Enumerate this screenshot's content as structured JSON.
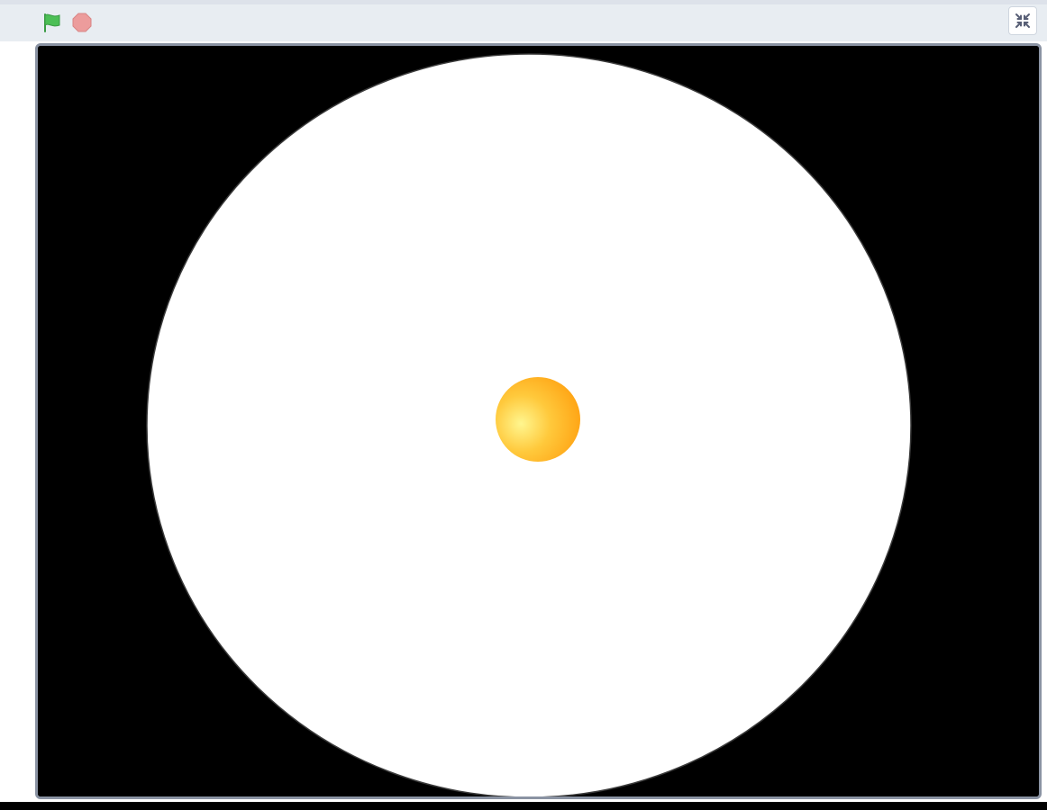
{
  "toolbar": {
    "green_flag": {
      "icon": "green-flag-icon",
      "color": "#4cbf56"
    },
    "stop": {
      "icon": "stop-sign-icon",
      "color": "#ec9c9c"
    },
    "exit_fullscreen": {
      "icon": "shrink-icon",
      "color": "#575e75"
    }
  },
  "stage": {
    "background_color": "#000000",
    "disc_color": "#ffffff",
    "ball_colors": {
      "highlight": "#fff68f",
      "mid": "#ffc93c",
      "edge": "#ff9f0f"
    }
  }
}
